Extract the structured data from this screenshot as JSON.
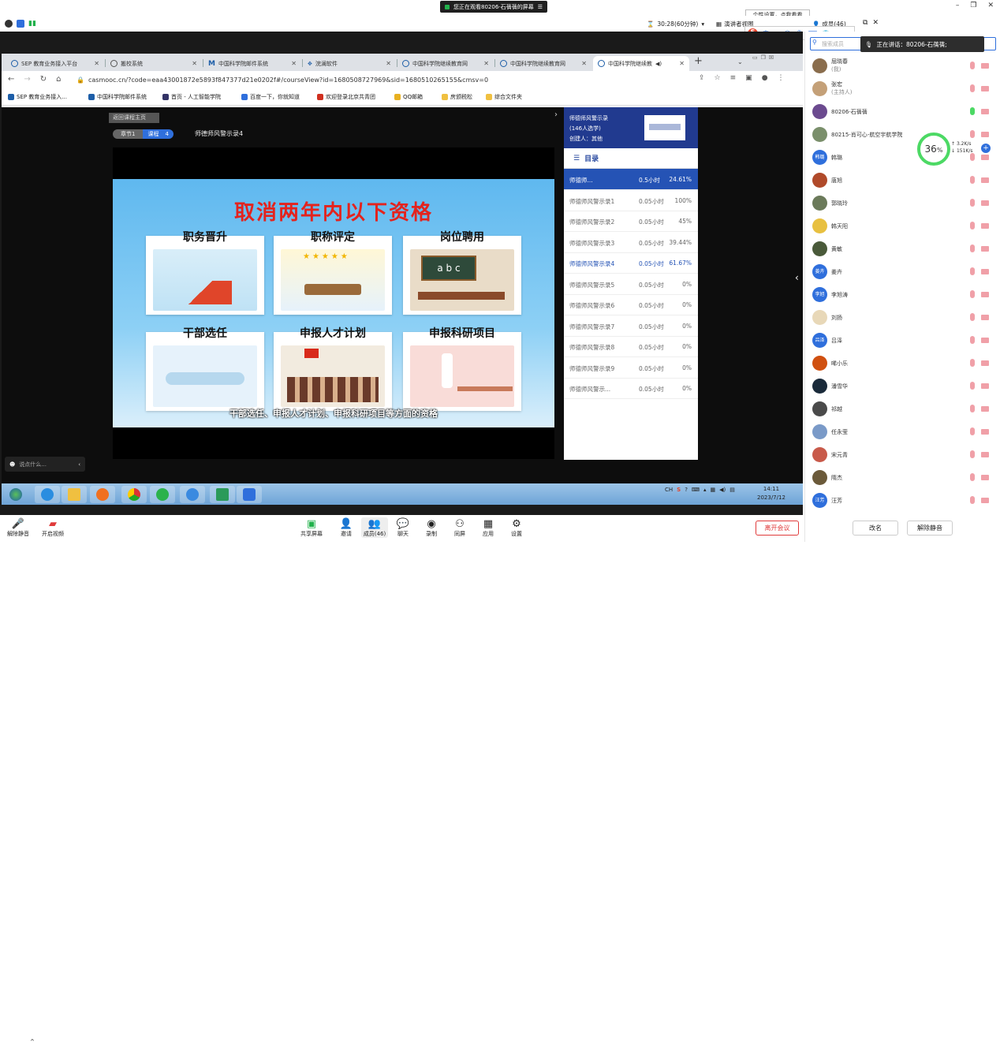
{
  "meeting": {
    "screen_notice": "您正在观看80206-石蒨蒨的屏幕",
    "popup": "个性设置，点我看看",
    "timer": "30:28(60分钟)",
    "presenter_view": "演讲者视图",
    "members_label": "成员(46)",
    "speaking": "正在讲话：80206-石蒨蒨;",
    "search_placeholder": "搜索成员"
  },
  "browser": {
    "tabs": [
      {
        "label": "SEP 教育业务接入平台"
      },
      {
        "label": "搬校系统"
      },
      {
        "label": "中国科学院邮件系统"
      },
      {
        "label": "浣澜软件"
      },
      {
        "label": "中国科学院继续教育网"
      },
      {
        "label": "中国科学院继续教育网"
      },
      {
        "label": "中国科学院继续教"
      }
    ],
    "url": "casmooc.cn/?code=eaa43001872e5893f847377d21e0202f#/courseView?id=1680508727969&sid=1680510265155&cmsv=0",
    "bookmarks": [
      "SEP 教育业务接入...",
      "中国科学院邮件系统",
      "首页 - 人工智能学院",
      "百度一下，你就知道",
      "欢迎登录北京共青团",
      "QQ邮箱",
      "房颁税松",
      "综合文件夹"
    ]
  },
  "course": {
    "back": "返回课程主页",
    "chapter": "章节1",
    "course_label": "课程",
    "course_num": "4",
    "lesson_title": "师德师风警示录4",
    "side_title": "师德师风警示录",
    "side_count": "(146人选学)",
    "side_creator": "创建人：其他",
    "toc_title": "目录",
    "toc": [
      {
        "name": "师德师...",
        "dur": "0.5小时",
        "pct": "24.61%"
      },
      {
        "name": "师德师风警示录1",
        "dur": "0.05小时",
        "pct": "100%"
      },
      {
        "name": "师德师风警示录2",
        "dur": "0.05小时",
        "pct": "45%"
      },
      {
        "name": "师德师风警示录3",
        "dur": "0.05小时",
        "pct": "39.44%"
      },
      {
        "name": "师德师风警示录4",
        "dur": "0.05小时",
        "pct": "61.67%"
      },
      {
        "name": "师德师风警示录5",
        "dur": "0.05小时",
        "pct": "0%"
      },
      {
        "name": "师德师风警示录6",
        "dur": "0.05小时",
        "pct": "0%"
      },
      {
        "name": "师德师风警示录7",
        "dur": "0.05小时",
        "pct": "0%"
      },
      {
        "name": "师德师风警示录8",
        "dur": "0.05小时",
        "pct": "0%"
      },
      {
        "name": "师德师风警示录9",
        "dur": "0.05小时",
        "pct": "0%"
      },
      {
        "name": "师德师风警示...",
        "dur": "0.05小时",
        "pct": "0%"
      }
    ]
  },
  "slide": {
    "title": "取消两年内以下资格",
    "cards": [
      "职务晋升",
      "职称评定",
      "岗位聘用",
      "干部选任",
      "申报人才计划",
      "申报科研项目"
    ],
    "subtitle": "干部选任、申报人才计划、申报科研项目等方面的资格",
    "letters": "a b c"
  },
  "chat_placeholder": "说点什么...",
  "taskbar": {
    "time": "14:11",
    "date": "2023/7/12",
    "ime": "CH"
  },
  "bottom": {
    "buttons": [
      "解除静音",
      "开启视频",
      "共享屏幕",
      "邀请",
      "成员(46)",
      "聊天",
      "录制",
      "同屏",
      "应用",
      "设置"
    ],
    "leave": "离开会议"
  },
  "members": [
    {
      "name": "屈晓春",
      "sub": "(我)",
      "color": "#8a6d4d"
    },
    {
      "name": "张宏",
      "sub": "(主持人)",
      "color": "#c4a078"
    },
    {
      "name": "80206-石蒨蒨",
      "color": "#6b4a8f"
    },
    {
      "name": "80215-肖可心-航空宇航学院",
      "color": "#7a8f6b"
    },
    {
      "name": "韩璐",
      "color": "#2f6fdc"
    },
    {
      "name": "唐旭",
      "color": "#b04a2a"
    },
    {
      "name": "郭晓玲",
      "color": "#6b7a5a"
    },
    {
      "name": "韩天阳",
      "color": "#e8c040"
    },
    {
      "name": "黄敏",
      "color": "#4a5a3a"
    },
    {
      "name": "姜卉",
      "color": "#2f6fdc"
    },
    {
      "name": "李旭涛",
      "color": "#2f6fdc"
    },
    {
      "name": "刘扬",
      "color": "#e8d8b8"
    },
    {
      "name": "吕泽",
      "color": "#2f6fdc"
    },
    {
      "name": "唏小乐",
      "color": "#d05010"
    },
    {
      "name": "潘雪华",
      "color": "#1a2a3a"
    },
    {
      "name": "祁越",
      "color": "#4a4a4a"
    },
    {
      "name": "任永莹",
      "color": "#7a9ac8"
    },
    {
      "name": "宋元青",
      "color": "#c85a4a"
    },
    {
      "name": "隋杰",
      "color": "#6b5a3a"
    },
    {
      "name": "汪芳",
      "color": "#2f6fdc"
    }
  ],
  "avatar_text": {
    "韩璐": "韩璐",
    "姜卉": "姜卉",
    "李旭涛": "李旭",
    "吕泽": "吕泽",
    "汪芳": "汪芳"
  },
  "network": {
    "pct": "36",
    "unit": "%",
    "up": "3.2K/s",
    "down": "151K/s"
  },
  "panel_buttons": [
    "改名",
    "解除静音"
  ]
}
